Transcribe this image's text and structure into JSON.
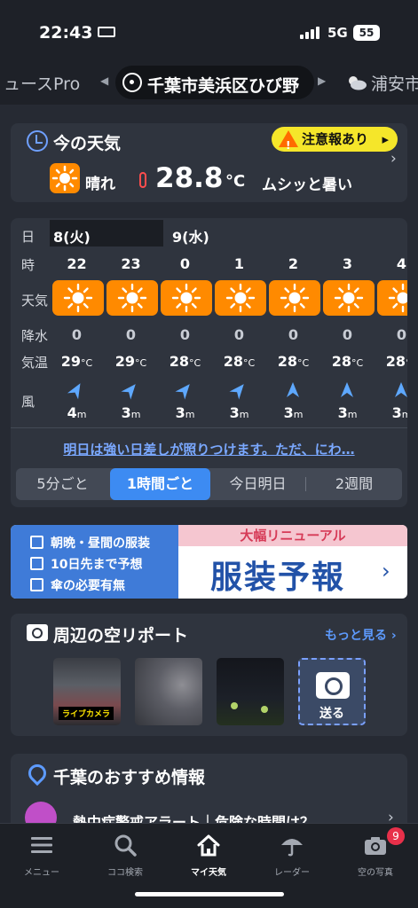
{
  "status": {
    "time": "22:43",
    "network": "5G",
    "battery": "55"
  },
  "locations": {
    "prev": "ュースPro",
    "current": "千葉市美浜区ひび野",
    "next": "浦安市"
  },
  "now": {
    "title": "今の天気",
    "alert": "注意報あり",
    "condition": "晴れ",
    "temp": "28.8",
    "unit": "°C",
    "feel": "ムシッと暑い"
  },
  "hourly": {
    "labels": {
      "day": "日",
      "hour": "時",
      "weather": "天気",
      "precip": "降水",
      "temp": "気温",
      "wind": "風"
    },
    "days": [
      "8(火)",
      "9(水)"
    ],
    "hours": [
      "22",
      "23",
      "0",
      "1",
      "2",
      "3",
      "4"
    ],
    "precip": [
      "0",
      "0",
      "0",
      "0",
      "0",
      "0",
      "0"
    ],
    "temps": [
      "29",
      "29",
      "28",
      "28",
      "28",
      "28",
      "28"
    ],
    "temp_unit": "°C",
    "wind": [
      "4",
      "3",
      "3",
      "3",
      "3",
      "3",
      "3"
    ],
    "wind_unit": "m",
    "wind_dir_deg": [
      30,
      40,
      40,
      40,
      0,
      0,
      0
    ],
    "tomorrow_text": "明日は強い日差しが照りつけます。ただ、にわ…",
    "segments": [
      "5分ごと",
      "1時間ごと",
      "今日明日",
      "2週間"
    ],
    "active_segment": 1
  },
  "banner": {
    "items": [
      "朝晩・昼間の服装",
      "10日先まで予想",
      "傘の必要有無"
    ],
    "ribbon": "大幅リニューアル",
    "headline": "服装予報"
  },
  "sky": {
    "title": "周辺の空リポート",
    "more": "もっと見る",
    "live_caption": "ライブカメラ",
    "send": "送る"
  },
  "recommend": {
    "title": "千葉のおすすめ情報",
    "item": "熱中症警戒アラート｜危険な時間は？"
  },
  "tabs": [
    {
      "label": "メニュー",
      "icon": "menu-icon"
    },
    {
      "label": "ココ検索",
      "icon": "search-icon"
    },
    {
      "label": "マイ天気",
      "icon": "home-icon"
    },
    {
      "label": "レーダー",
      "icon": "umbrella-icon"
    },
    {
      "label": "空の写真",
      "icon": "camera-icon",
      "badge": "9"
    }
  ],
  "colors": {
    "accent": "#3d8bf2",
    "sun_tile": "#ff8a00",
    "alert": "#f5e62a",
    "link": "#5d9bff",
    "background": "#262a33"
  }
}
